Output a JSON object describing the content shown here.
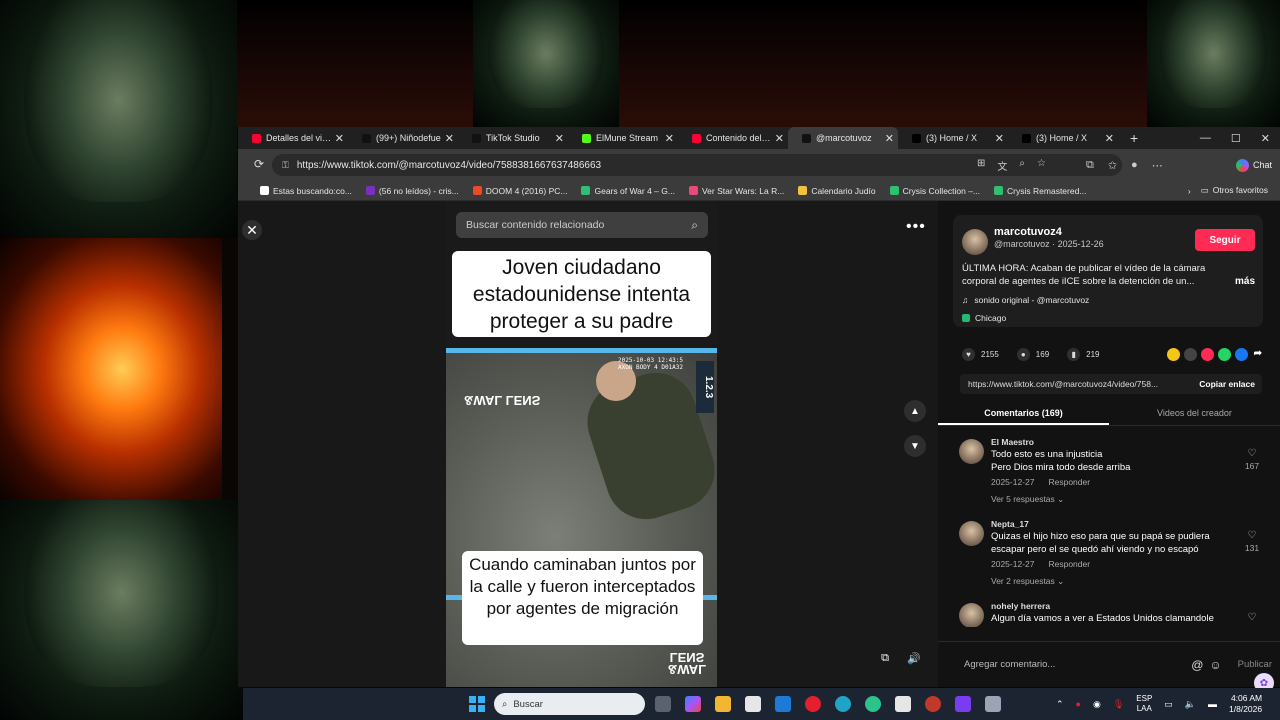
{
  "browser": {
    "tabs": [
      {
        "label": "Detalles del video",
        "favicon_color": "#ff0033",
        "active": false
      },
      {
        "label": "(99+) Niñodefue",
        "favicon_color": "#111111",
        "active": false
      },
      {
        "label": "TikTok Studio",
        "favicon_color": "#111111",
        "active": false
      },
      {
        "label": "ElMune Stream",
        "favicon_color": "#53fc18",
        "active": false
      },
      {
        "label": "Contenido del cana",
        "favicon_color": "#ff0033",
        "active": false
      },
      {
        "label": "@marcotuvoz",
        "favicon_color": "#111111",
        "active": true
      },
      {
        "label": "(3) Home / X",
        "favicon_color": "#000000",
        "active": false
      },
      {
        "label": "(3) Home / X",
        "favicon_color": "#000000",
        "active": false
      }
    ],
    "new_tab_label": "+",
    "url": "https://www.tiktok.com/@marcotuvoz4/video/7588381667637486663",
    "chat_label": "Chat",
    "bookmarks": [
      {
        "label": "Estas buscando:co...",
        "color": "#ffffff"
      },
      {
        "label": "(56 no leídos) - cris...",
        "color": "#7b2fbf"
      },
      {
        "label": "DOOM 4 (2016) PC...",
        "color": "#e84a2a"
      },
      {
        "label": "Gears of War 4 – G...",
        "color": "#2fbf71"
      },
      {
        "label": "Ver Star Wars: La R...",
        "color": "#e84a7a"
      },
      {
        "label": "Calendario Judío",
        "color": "#f0c33c"
      },
      {
        "label": "Crysis Collection –...",
        "color": "#2fbf71"
      },
      {
        "label": "Crysis Remastered...",
        "color": "#2fbf71"
      }
    ],
    "other_bookmarks": "Otros favoritos"
  },
  "video": {
    "search_placeholder": "Buscar contenido relacionado",
    "caption_top": "Joven ciudadano estadounidense intenta proteger a su padre",
    "caption_bottom": "Cuando caminaban juntos por la calle y fueron interceptados por agentes de migración",
    "overlay_stamp": "2025-10-03 12:43:5\nAXON BODY 4 D01A32",
    "watermark": "&WAL\nLENS",
    "side_label": "1.2.3"
  },
  "author": {
    "name": "marcotuvoz4",
    "handle_date": "@marcotuvoz · 2025-12-26",
    "follow_label": "Seguir",
    "description": "ÚLTIMA HORA: Acaban de publicar el vídeo de la cámara corporal de agentes de iICE sobre la detención de un...",
    "more_label": "más",
    "sound": "sonido original - @marcotuvoz",
    "location": "Chicago"
  },
  "stats": {
    "likes": "2155",
    "comments": "169",
    "saves": "219"
  },
  "share_colors": [
    "#f5c518",
    "#444444",
    "#fe2c55",
    "#25d366",
    "#1877f2"
  ],
  "link": {
    "url": "https://www.tiktok.com/@marcotuvoz4/video/758...",
    "copy_label": "Copiar enlace"
  },
  "tabs": {
    "comments": "Comentarios (169)",
    "creator_videos": "Videos del creador"
  },
  "comments": [
    {
      "user": "El Maestro",
      "text": "Todo esto es una injusticia\nPero Dios mira todo desde arriba",
      "date": "2025-12-27",
      "reply": "Responder",
      "replies": "Ver 5 respuestas",
      "likes": "167"
    },
    {
      "user": "Nepta_17",
      "text": "Quizas el hijo hizo eso para que su papá se pudiera escapar pero el se quedó ahí viendo y no escapó",
      "date": "2025-12-27",
      "reply": "Responder",
      "replies": "Ver 2 respuestas",
      "likes": "131"
    },
    {
      "user": "nohely herrera",
      "text": "Algun día vamos a ver a Estados Unidos clamandole",
      "date": "",
      "reply": "",
      "replies": "",
      "likes": ""
    }
  ],
  "add_comment": {
    "placeholder": "Agregar comentario...",
    "publish_label": "Publicar"
  },
  "taskbar": {
    "search_placeholder": "Buscar",
    "language": "ESP\nLAA",
    "time": "4:06 AM",
    "date": "1/8/2026"
  }
}
